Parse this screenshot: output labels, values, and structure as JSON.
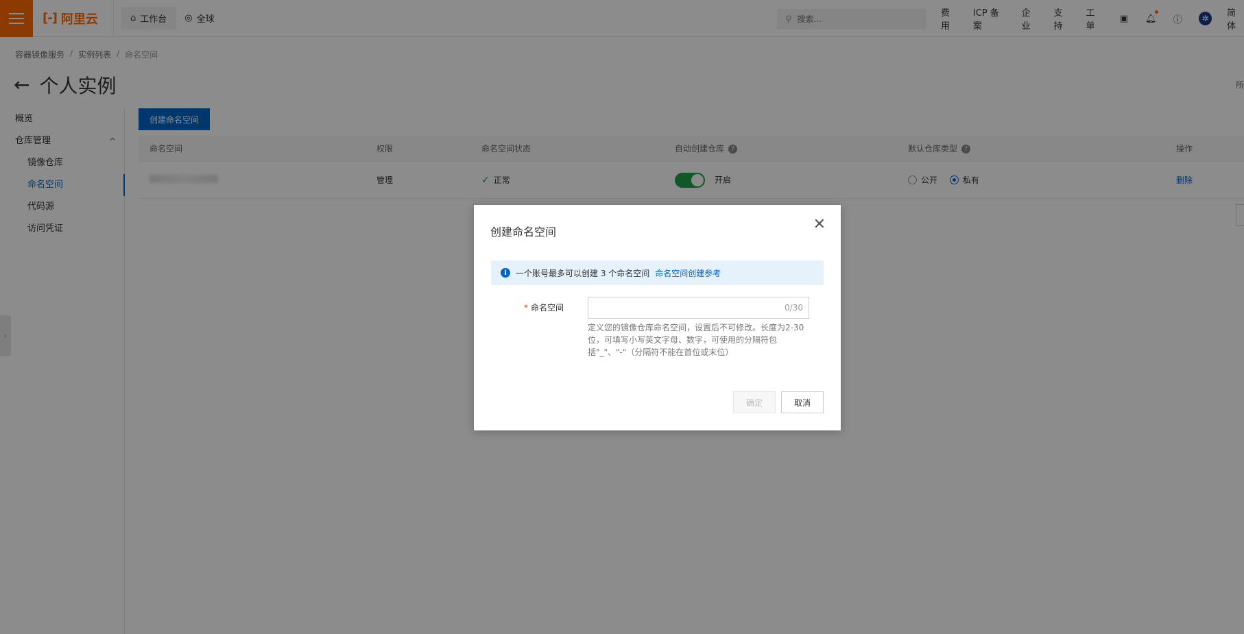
{
  "topbar": {
    "logo_text": "阿里云",
    "logo_mark": "[-]",
    "workbench": "工作台",
    "region": "全球",
    "search_placeholder": "搜索...",
    "nav": [
      "费用",
      "ICP 备案",
      "企业",
      "支持",
      "工单"
    ],
    "lang": "简体",
    "accent": "#ff6a00"
  },
  "breadcrumb": [
    "容器镜像服务",
    "实例列表",
    "命名空间"
  ],
  "page_title": "个人实例",
  "corner_text": "所",
  "sidebar": {
    "overview": "概览",
    "repo_mgmt": "仓库管理",
    "items": [
      "镜像仓库",
      "命名空间",
      "代码源",
      "访问凭证"
    ]
  },
  "main": {
    "create_button": "创建命名空间",
    "columns": [
      "命名空间",
      "权限",
      "命名空间状态",
      "自动创建仓库",
      "默认仓库类型",
      "操作"
    ],
    "row": {
      "permission": "管理",
      "status": "正常",
      "auto_create": "开启",
      "type_public": "公开",
      "type_private": "私有",
      "action": "删除"
    }
  },
  "modal": {
    "title": "创建命名空间",
    "info_text": "一个账号最多可以创建 3 个命名空间",
    "info_link": "命名空间创建参考",
    "field_label": "命名空间",
    "field_value": "",
    "counter": "0/30",
    "hint": "定义您的镜像仓库命名空间，设置后不可修改。长度为2-30位，可填写小写英文字母、数字，可使用的分隔符包括\"_\"、\"-\"（分隔符不能在首位或末位）",
    "ok": "确定",
    "cancel": "取消"
  }
}
